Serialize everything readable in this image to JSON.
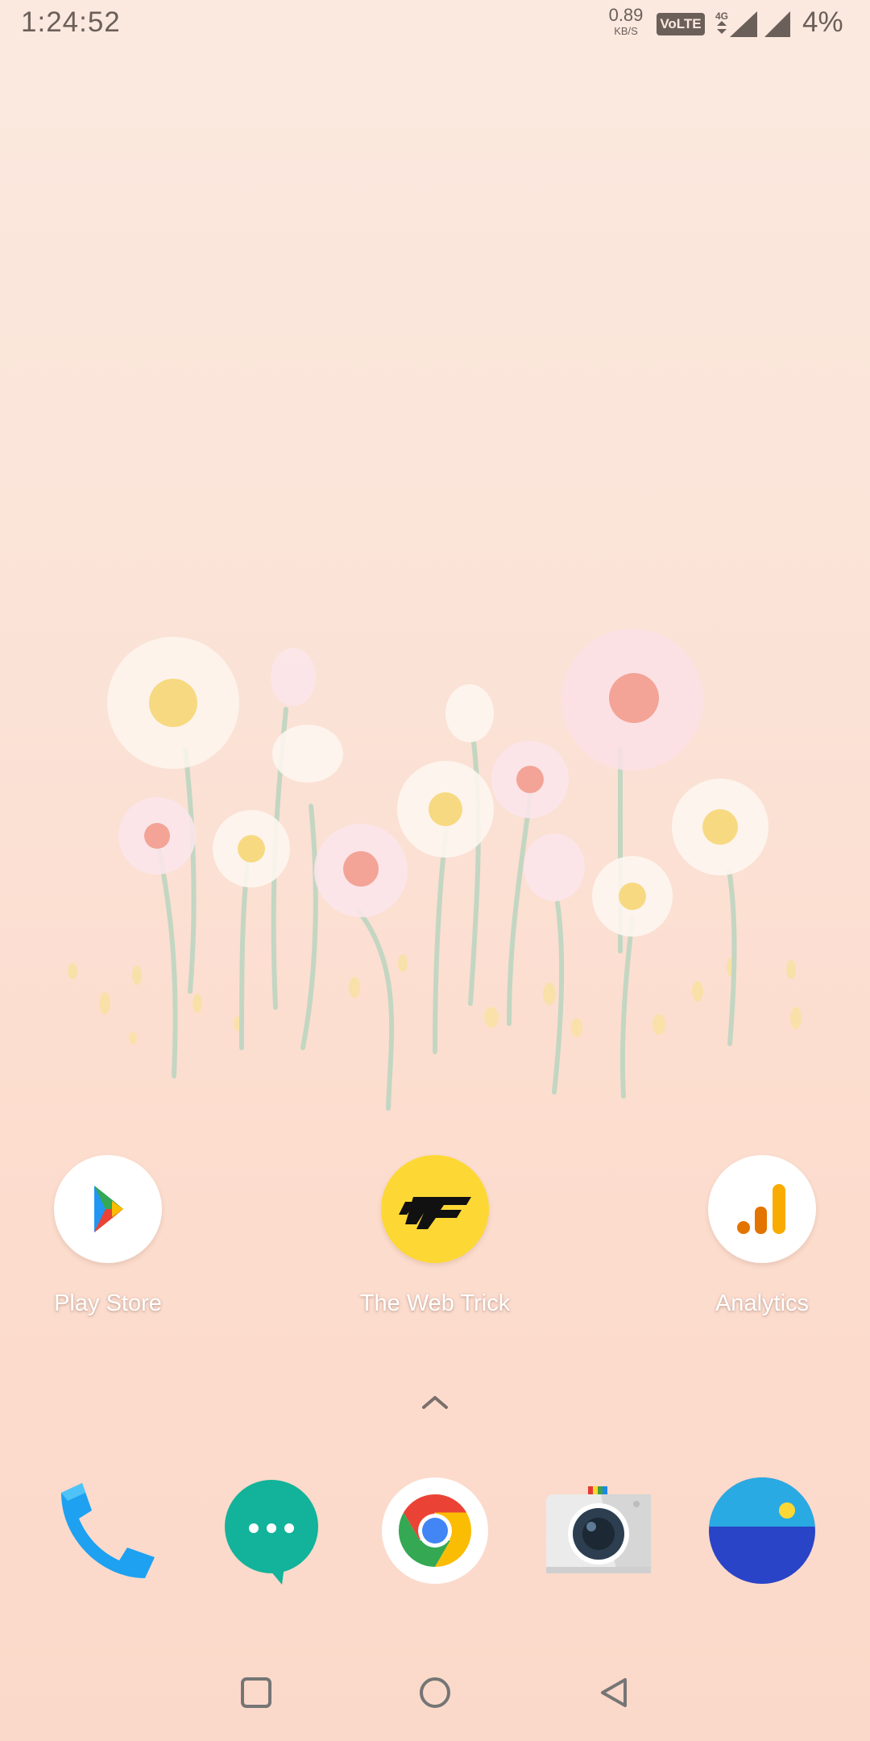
{
  "status_bar": {
    "time": "1:24:52",
    "net_speed_value": "0.89",
    "net_speed_unit": "KB/S",
    "volte_label": "VoLTE",
    "network_type": "4G",
    "battery": "4%"
  },
  "home_apps": [
    {
      "label": "Play Store",
      "icon": "play-store-icon"
    },
    {
      "label": "The Web Trick",
      "icon": "web-trick-icon"
    },
    {
      "label": "Analytics",
      "icon": "analytics-icon"
    }
  ],
  "dock": [
    {
      "icon": "phone-icon",
      "color": "#1ea1f1"
    },
    {
      "icon": "messages-icon",
      "color": "#12b39a"
    },
    {
      "icon": "chrome-icon",
      "color": "#4285f4"
    },
    {
      "icon": "camera-icon",
      "color": "#e6e6e6"
    },
    {
      "icon": "gallery-icon",
      "color": "#2a44c7"
    }
  ],
  "nav_bar": {
    "recents": "square-icon",
    "home": "circle-icon",
    "back": "triangle-back-icon"
  },
  "colors": {
    "background": "#fbe2d6",
    "status_text": "#6b5f5a",
    "label_text": "#ffffff"
  }
}
